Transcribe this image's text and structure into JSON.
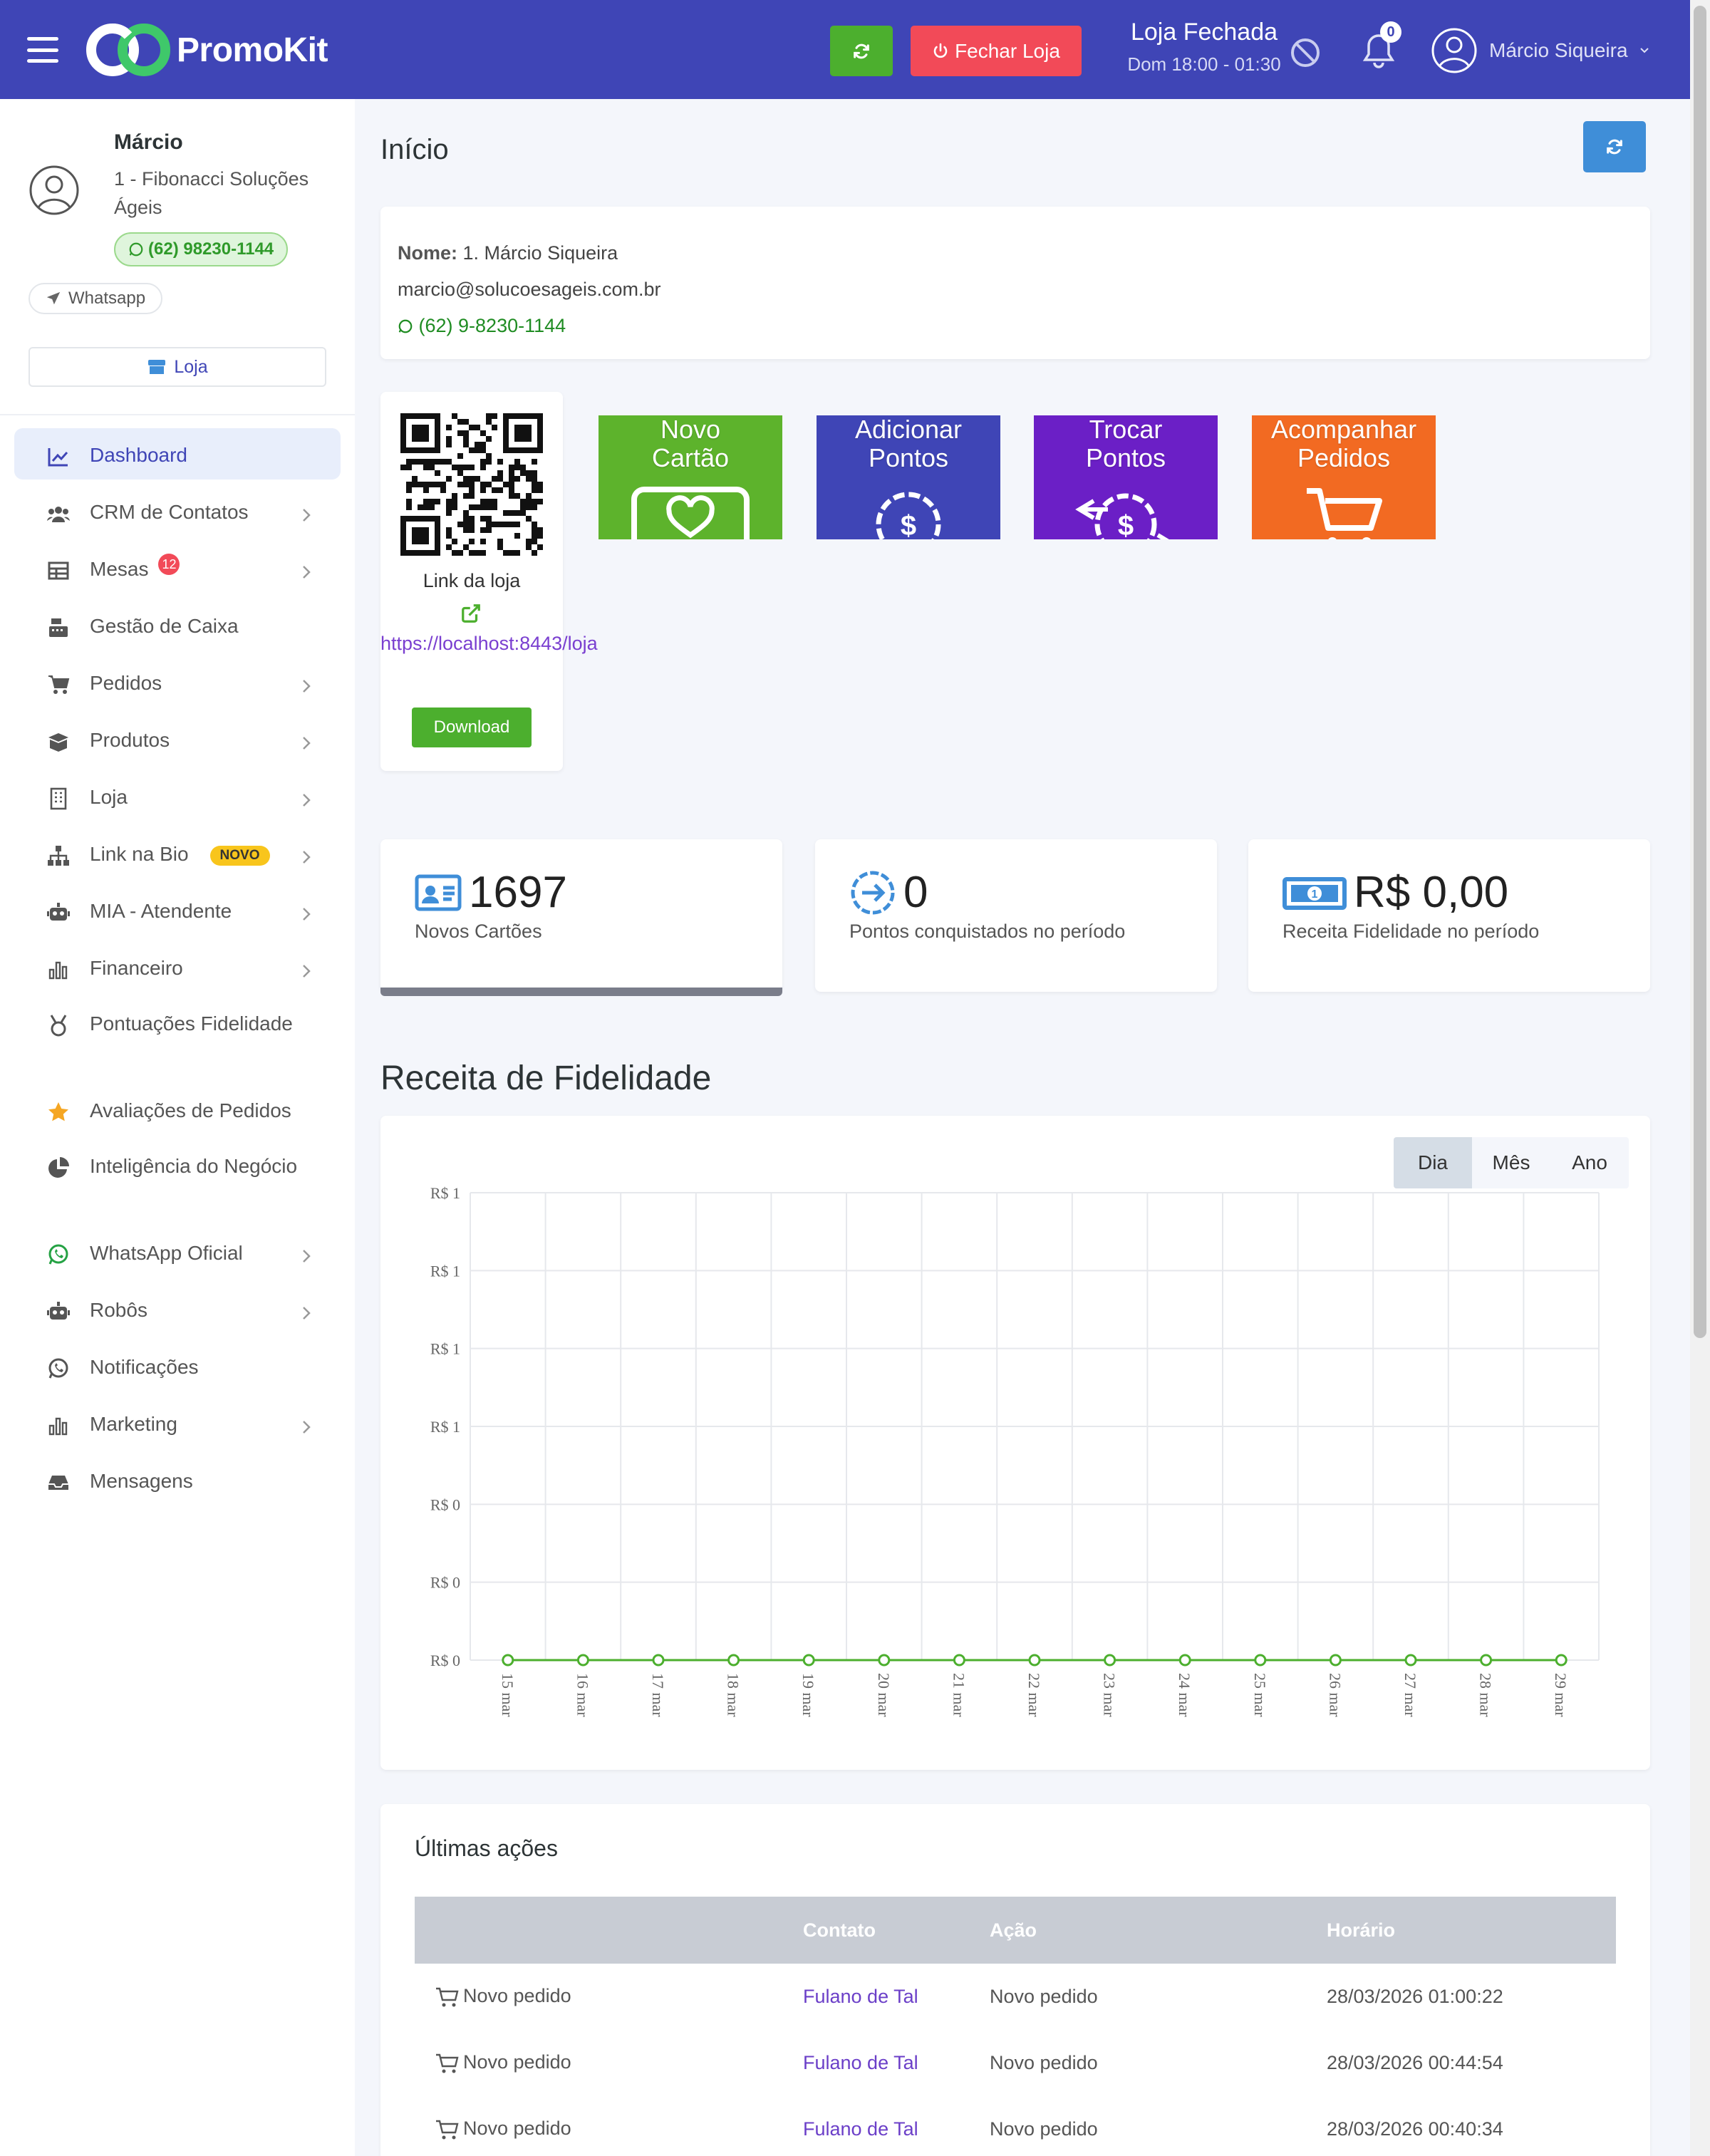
{
  "header": {
    "brand": "PromoKit",
    "close_store_label": "Fechar Loja",
    "store_status": "Loja Fechada",
    "store_hours": "Dom 18:00 - 01:30",
    "notifications_count": "0",
    "user_name": "Márcio Siqueira",
    "colors": {
      "bar": "#3f45b6",
      "refresh": "#4caf2e",
      "close": "#f24a58"
    }
  },
  "profile": {
    "name": "Márcio",
    "company": "1 - Fibonacci Soluções Ágeis",
    "phone": "(62) 98230-1144",
    "whatsapp_label": "Whatsapp",
    "store_button": "Loja"
  },
  "nav": {
    "items": [
      {
        "label": "Dashboard",
        "icon": "chart-line-icon",
        "active": true
      },
      {
        "label": "CRM de Contatos",
        "icon": "users-icon"
      },
      {
        "label": "Mesas",
        "icon": "table-icon",
        "badge": "12"
      },
      {
        "label": "Gestão de Caixa",
        "icon": "cash-register-icon"
      },
      {
        "label": "Pedidos",
        "icon": "cart-icon"
      },
      {
        "label": "Produtos",
        "icon": "box-icon"
      },
      {
        "label": "Loja",
        "icon": "building-icon"
      },
      {
        "label": "Link na Bio",
        "icon": "sitemap-icon",
        "tag": "NOVO"
      },
      {
        "label": "MIA - Atendente",
        "icon": "robot-icon"
      },
      {
        "label": "Financeiro",
        "icon": "bar-chart-icon"
      },
      {
        "label": "Pontuações Fidelidade",
        "icon": "medal-icon"
      },
      {
        "label": "Avaliações de Pedidos",
        "icon": "star-icon"
      },
      {
        "label": "Inteligência do Negócio",
        "icon": "pie-chart-icon"
      },
      {
        "label": "WhatsApp Oficial",
        "icon": "whatsapp-icon"
      },
      {
        "label": "Robôs",
        "icon": "robot-icon"
      },
      {
        "label": "Notificações",
        "icon": "whatsapp-icon"
      },
      {
        "label": "Marketing",
        "icon": "bar-chart-icon"
      },
      {
        "label": "Mensagens",
        "icon": "inbox-icon"
      }
    ]
  },
  "page": {
    "title": "Início"
  },
  "info": {
    "name_label": "Nome:",
    "name_value": "1. Márcio Siqueira",
    "email": "marcio@solucoesageis.com.br",
    "phone": "(62) 9-8230-1144"
  },
  "qr": {
    "link_label": "Link da loja",
    "url": "https://localhost:8443/loja",
    "download_label": "Download"
  },
  "tiles": [
    {
      "line1": "Novo",
      "line2": "Cartão",
      "color": "#5db32c"
    },
    {
      "line1": "Adicionar",
      "line2": "Pontos",
      "color": "#3f45b6"
    },
    {
      "line1": "Trocar",
      "line2": "Pontos",
      "color": "#6b1fc6"
    },
    {
      "line1": "Acompanhar",
      "line2": "Pedidos",
      "color": "#f26a22"
    }
  ],
  "stats": [
    {
      "value": "1697",
      "label": "Novos Cartões"
    },
    {
      "value": "0",
      "label": "Pontos conquistados no período"
    },
    {
      "value": "R$ 0,00",
      "label": "Receita Fidelidade no período"
    }
  ],
  "chart_section": {
    "title": "Receita de Fidelidade",
    "periods": [
      "Dia",
      "Mês",
      "Ano"
    ],
    "active_period": "Dia"
  },
  "chart_data": {
    "type": "line",
    "title": "",
    "xlabel": "",
    "ylabel": "",
    "categories": [
      "15 mar",
      "16 mar",
      "17 mar",
      "18 mar",
      "19 mar",
      "20 mar",
      "21 mar",
      "22 mar",
      "23 mar",
      "24 mar",
      "25 mar",
      "26 mar",
      "27 mar",
      "28 mar",
      "29 mar"
    ],
    "series": [
      {
        "values": [
          0,
          0,
          0,
          0,
          0,
          0,
          0,
          0,
          0,
          0,
          0,
          0,
          0,
          0,
          0
        ],
        "color": "#4caf2e"
      }
    ],
    "y_tick_labels": [
      "R$ 1",
      "R$ 1",
      "R$ 1",
      "R$ 1",
      "R$ 0",
      "R$ 0",
      "R$ 0"
    ],
    "ylim": [
      0,
      1
    ],
    "grid": true
  },
  "actions": {
    "title": "Últimas ações",
    "headers": [
      "",
      "Contato",
      "Ação",
      "Horário"
    ],
    "rows": [
      {
        "type": "Novo pedido",
        "contact": "Fulano de Tal",
        "action": "Novo pedido",
        "time": "28/03/2026 01:00:22"
      },
      {
        "type": "Novo pedido",
        "contact": "Fulano de Tal",
        "action": "Novo pedido",
        "time": "28/03/2026 00:44:54"
      },
      {
        "type": "Novo pedido",
        "contact": "Fulano de Tal",
        "action": "Novo pedido",
        "time": "28/03/2026 00:40:34"
      }
    ]
  }
}
